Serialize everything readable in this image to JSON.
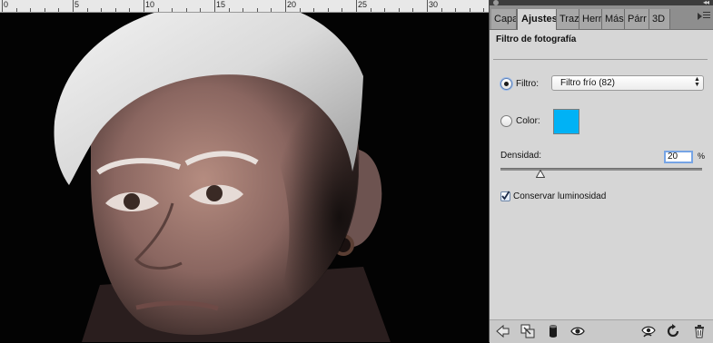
{
  "ruler": {
    "labels": [
      "0",
      "5",
      "10",
      "15",
      "20",
      "25",
      "30"
    ]
  },
  "panel": {
    "tabs": [
      {
        "label": "Capa",
        "active": false
      },
      {
        "label": "Ajustes",
        "active": true
      },
      {
        "label": "Traz",
        "active": false
      },
      {
        "label": "Herr",
        "active": false
      },
      {
        "label": "Más",
        "active": false
      },
      {
        "label": "Párr",
        "active": false
      },
      {
        "label": "3D",
        "active": false
      }
    ],
    "title": "Filtro de fotografía",
    "filter": {
      "label": "Filtro:",
      "selected": true,
      "value": "Filtro frío (82)"
    },
    "color": {
      "label": "Color:",
      "selected": false,
      "swatch": "#00b2f5"
    },
    "density": {
      "label": "Densidad:",
      "value": "20",
      "unit": "%",
      "level": 0.2
    },
    "preserve": {
      "label": "Conservar luminosidad",
      "checked": true
    },
    "bottom_icons": [
      "back-arrow-icon",
      "clip-to-layer-icon",
      "visibility-state-icon",
      "eye-icon",
      "view-previous-icon",
      "reset-icon",
      "trash-icon"
    ]
  }
}
